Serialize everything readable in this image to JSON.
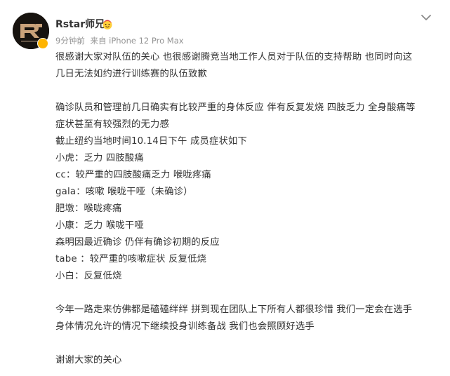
{
  "post": {
    "author": "Rstar师兄",
    "time": "9分钟前",
    "source": "来自 iPhone 12 Pro Max",
    "lines": [
      "很感谢大家对队伍的关心 也很感谢腾竞当地工作人员对于队伍的支持帮助 也同时向这",
      "几日无法如约进行训练赛的队伍致歉",
      "",
      "确诊队员和管理前几日确实有比较严重的身体反应 伴有反复发烧 四肢乏力 全身酸痛等",
      "症状甚至有较强烈的无力感",
      "截止纽约当地时间10.14日下午 成员症状如下",
      "小虎：乏力 四肢酸痛",
      "cc：较严重的四肢酸痛乏力 喉咙疼痛",
      "gala：咳嗽 喉咙干哑（未确诊）",
      "肥墩：喉咙疼痛",
      "小康：乏力 喉咙干哑",
      "森明因最近确诊 仍伴有确诊初期的反应",
      "tabe ：较严重的咳嗽症状 反复低烧",
      "小白：反复低烧",
      "",
      "今年一路走来仿佛都是磕磕绊绊 拼到现在团队上下所有人都很珍惜 我们一定会在选手",
      "身体情况允许的情况下继续投身训练备战 我们也会照顾好选手",
      "",
      "谢谢大家的关心"
    ]
  },
  "icons": {
    "avatar": "rng-logo-avatar",
    "verified": "verified-badge-icon",
    "member": "member-emoji-icon",
    "menu": "chevron-down-icon"
  },
  "colors": {
    "text": "#333333",
    "meta": "#939393",
    "verified": "#ffb400"
  }
}
